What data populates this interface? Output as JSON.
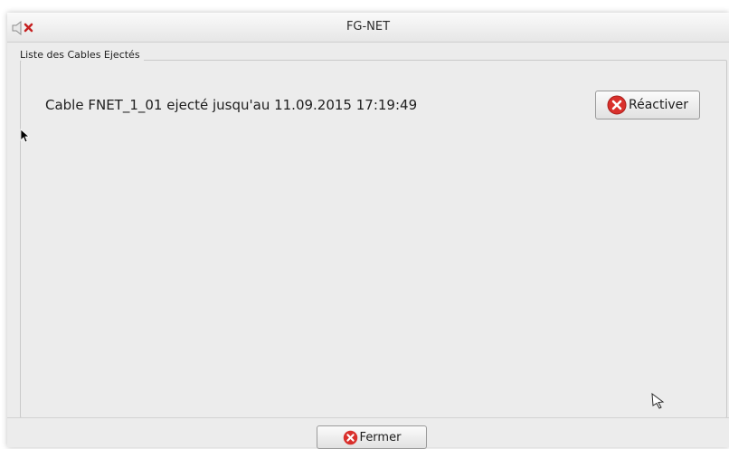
{
  "window": {
    "title": "FG-NET"
  },
  "group": {
    "legend": "Liste des Cables Ejectés"
  },
  "cables": [
    {
      "text": "Cable FNET_1_01 ejecté jusqu'au 11.09.2015 17:19:49",
      "action_label": "Réactiver"
    }
  ],
  "footer": {
    "close_label": "Fermer"
  },
  "icons": {
    "title_icon": "speaker-muted-icon",
    "action_icon": "error-circle-icon",
    "close_icon": "error-circle-icon"
  },
  "colors": {
    "error_red": "#d9302c"
  }
}
